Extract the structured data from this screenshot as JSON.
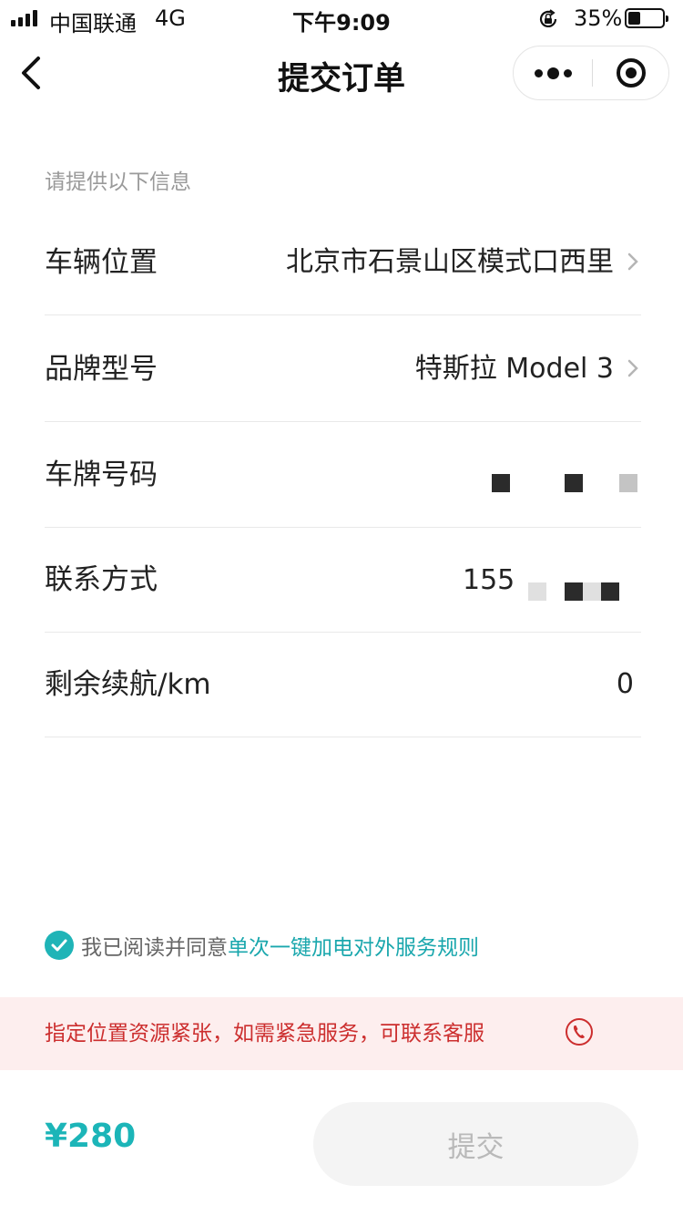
{
  "status_bar": {
    "carrier": "中国联通",
    "network": "4G",
    "time": "下午9:09",
    "battery_percent": "35%",
    "battery_level": 0.35
  },
  "nav": {
    "title": "提交订单",
    "back_icon": "chevron-left-icon",
    "more_icon": "more-dots-icon",
    "close_icon": "target-close-icon"
  },
  "form": {
    "hint": "请提供以下信息",
    "rows": [
      {
        "label": "车辆位置",
        "value": "北京市石景山区模式口西里"
      },
      {
        "label": "品牌型号",
        "value": "特斯拉 Model 3"
      },
      {
        "label": "车牌号码",
        "value": ""
      },
      {
        "label": "联系方式",
        "value": "155"
      },
      {
        "label": "剩余续航/km",
        "value": "0"
      }
    ]
  },
  "agreement": {
    "text": "我已阅读并同意",
    "link": "单次一键加电对外服务规则",
    "checked": true
  },
  "notice": {
    "text": "指定位置资源紧张，如需紧急服务，可联系客服",
    "icon": "phone-icon"
  },
  "footer": {
    "price": "¥280",
    "submit_label": "提交"
  },
  "colors": {
    "accent": "#1cb5b8",
    "warning_text": "#cc2e2e",
    "warning_bg": "#fdeeee"
  }
}
